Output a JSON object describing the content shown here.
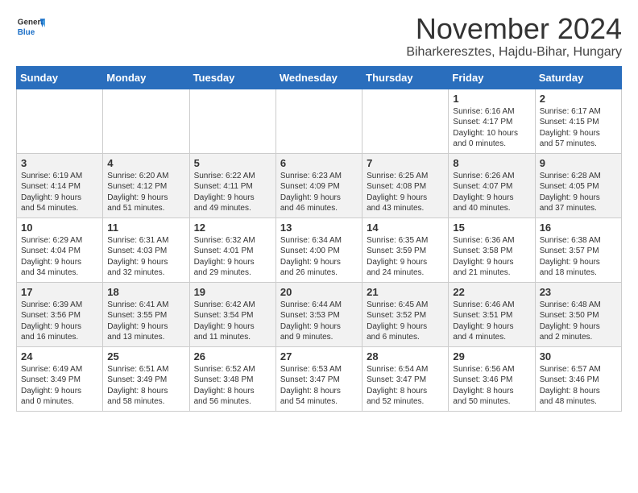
{
  "header": {
    "logo": {
      "general": "General",
      "blue": "Blue"
    },
    "month": "November 2024",
    "location": "Biharkeresztes, Hajdu-Bihar, Hungary"
  },
  "weekdays": [
    "Sunday",
    "Monday",
    "Tuesday",
    "Wednesday",
    "Thursday",
    "Friday",
    "Saturday"
  ],
  "weeks": [
    [
      {
        "day": "",
        "info": ""
      },
      {
        "day": "",
        "info": ""
      },
      {
        "day": "",
        "info": ""
      },
      {
        "day": "",
        "info": ""
      },
      {
        "day": "",
        "info": ""
      },
      {
        "day": "1",
        "info": "Sunrise: 6:16 AM\nSunset: 4:17 PM\nDaylight: 10 hours\nand 0 minutes."
      },
      {
        "day": "2",
        "info": "Sunrise: 6:17 AM\nSunset: 4:15 PM\nDaylight: 9 hours\nand 57 minutes."
      }
    ],
    [
      {
        "day": "3",
        "info": "Sunrise: 6:19 AM\nSunset: 4:14 PM\nDaylight: 9 hours\nand 54 minutes."
      },
      {
        "day": "4",
        "info": "Sunrise: 6:20 AM\nSunset: 4:12 PM\nDaylight: 9 hours\nand 51 minutes."
      },
      {
        "day": "5",
        "info": "Sunrise: 6:22 AM\nSunset: 4:11 PM\nDaylight: 9 hours\nand 49 minutes."
      },
      {
        "day": "6",
        "info": "Sunrise: 6:23 AM\nSunset: 4:09 PM\nDaylight: 9 hours\nand 46 minutes."
      },
      {
        "day": "7",
        "info": "Sunrise: 6:25 AM\nSunset: 4:08 PM\nDaylight: 9 hours\nand 43 minutes."
      },
      {
        "day": "8",
        "info": "Sunrise: 6:26 AM\nSunset: 4:07 PM\nDaylight: 9 hours\nand 40 minutes."
      },
      {
        "day": "9",
        "info": "Sunrise: 6:28 AM\nSunset: 4:05 PM\nDaylight: 9 hours\nand 37 minutes."
      }
    ],
    [
      {
        "day": "10",
        "info": "Sunrise: 6:29 AM\nSunset: 4:04 PM\nDaylight: 9 hours\nand 34 minutes."
      },
      {
        "day": "11",
        "info": "Sunrise: 6:31 AM\nSunset: 4:03 PM\nDaylight: 9 hours\nand 32 minutes."
      },
      {
        "day": "12",
        "info": "Sunrise: 6:32 AM\nSunset: 4:01 PM\nDaylight: 9 hours\nand 29 minutes."
      },
      {
        "day": "13",
        "info": "Sunrise: 6:34 AM\nSunset: 4:00 PM\nDaylight: 9 hours\nand 26 minutes."
      },
      {
        "day": "14",
        "info": "Sunrise: 6:35 AM\nSunset: 3:59 PM\nDaylight: 9 hours\nand 24 minutes."
      },
      {
        "day": "15",
        "info": "Sunrise: 6:36 AM\nSunset: 3:58 PM\nDaylight: 9 hours\nand 21 minutes."
      },
      {
        "day": "16",
        "info": "Sunrise: 6:38 AM\nSunset: 3:57 PM\nDaylight: 9 hours\nand 18 minutes."
      }
    ],
    [
      {
        "day": "17",
        "info": "Sunrise: 6:39 AM\nSunset: 3:56 PM\nDaylight: 9 hours\nand 16 minutes."
      },
      {
        "day": "18",
        "info": "Sunrise: 6:41 AM\nSunset: 3:55 PM\nDaylight: 9 hours\nand 13 minutes."
      },
      {
        "day": "19",
        "info": "Sunrise: 6:42 AM\nSunset: 3:54 PM\nDaylight: 9 hours\nand 11 minutes."
      },
      {
        "day": "20",
        "info": "Sunrise: 6:44 AM\nSunset: 3:53 PM\nDaylight: 9 hours\nand 9 minutes."
      },
      {
        "day": "21",
        "info": "Sunrise: 6:45 AM\nSunset: 3:52 PM\nDaylight: 9 hours\nand 6 minutes."
      },
      {
        "day": "22",
        "info": "Sunrise: 6:46 AM\nSunset: 3:51 PM\nDaylight: 9 hours\nand 4 minutes."
      },
      {
        "day": "23",
        "info": "Sunrise: 6:48 AM\nSunset: 3:50 PM\nDaylight: 9 hours\nand 2 minutes."
      }
    ],
    [
      {
        "day": "24",
        "info": "Sunrise: 6:49 AM\nSunset: 3:49 PM\nDaylight: 9 hours\nand 0 minutes."
      },
      {
        "day": "25",
        "info": "Sunrise: 6:51 AM\nSunset: 3:49 PM\nDaylight: 8 hours\nand 58 minutes."
      },
      {
        "day": "26",
        "info": "Sunrise: 6:52 AM\nSunset: 3:48 PM\nDaylight: 8 hours\nand 56 minutes."
      },
      {
        "day": "27",
        "info": "Sunrise: 6:53 AM\nSunset: 3:47 PM\nDaylight: 8 hours\nand 54 minutes."
      },
      {
        "day": "28",
        "info": "Sunrise: 6:54 AM\nSunset: 3:47 PM\nDaylight: 8 hours\nand 52 minutes."
      },
      {
        "day": "29",
        "info": "Sunrise: 6:56 AM\nSunset: 3:46 PM\nDaylight: 8 hours\nand 50 minutes."
      },
      {
        "day": "30",
        "info": "Sunrise: 6:57 AM\nSunset: 3:46 PM\nDaylight: 8 hours\nand 48 minutes."
      }
    ]
  ]
}
